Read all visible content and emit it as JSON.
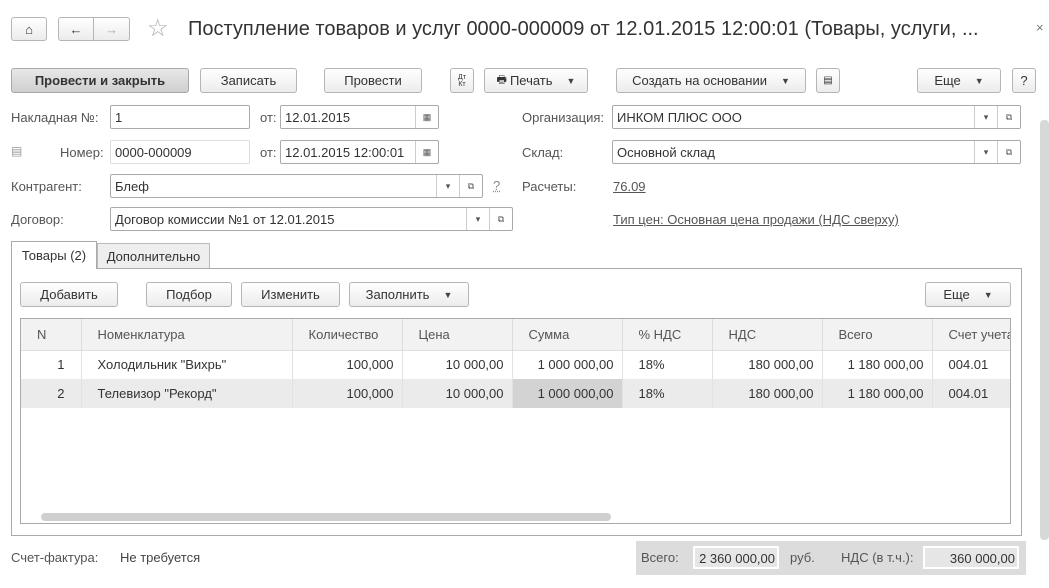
{
  "title": "Поступление товаров и услуг 0000-000009 от 12.01.2015 12:00:01 (Товары, услуги, ...",
  "toolbar": {
    "post_close": "Провести и закрыть",
    "save": "Записать",
    "post": "Провести",
    "dtkt": "Дт Кт",
    "print": "Печать",
    "create_based": "Создать на основании",
    "more": "Еще",
    "help": "?"
  },
  "form": {
    "invoice_label": "Накладная №:",
    "invoice_no": "1",
    "from_label": "от:",
    "invoice_date": "12.01.2015",
    "number_label": "Номер:",
    "number": "0000-000009",
    "number_date": "12.01.2015 12:00:01",
    "counterparty_label": "Контрагент:",
    "counterparty": "Блеф",
    "question": "?",
    "contract_label": "Договор:",
    "contract": "Договор комиссии №1 от 12.01.2015",
    "org_label": "Организация:",
    "org": "ИНКОМ ПЛЮС ООО",
    "warehouse_label": "Склад:",
    "warehouse": "Основной склад",
    "settlements_label": "Расчеты:",
    "settlements": "76.09",
    "price_type": "Тип цен: Основная цена продажи (НДС сверху)"
  },
  "tabs": [
    "Товары (2)",
    "Дополнительно"
  ],
  "grid_toolbar": {
    "add": "Добавить",
    "pick": "Подбор",
    "edit": "Изменить",
    "fill": "Заполнить",
    "more": "Еще"
  },
  "columns": [
    "N",
    "Номенклатура",
    "Количество",
    "Цена",
    "Сумма",
    "% НДС",
    "НДС",
    "Всего",
    "Счет учета"
  ],
  "rows": [
    [
      "1",
      "Холодильник \"Вихрь\"",
      "100,000",
      "10 000,00",
      "1 000 000,00",
      "18%",
      "180 000,00",
      "1 180 000,00",
      "004.01"
    ],
    [
      "2",
      "Телевизор \"Рекорд\"",
      "100,000",
      "10 000,00",
      "1 000 000,00",
      "18%",
      "180 000,00",
      "1 180 000,00",
      "004.01"
    ]
  ],
  "footer": {
    "invoice_label": "Счет-фактура:",
    "invoice_value": "Не требуется",
    "total_label": "Всего:",
    "total": "2 360 000,00",
    "currency": "руб.",
    "vat_label": "НДС (в т.ч.):",
    "vat": "360 000,00"
  }
}
